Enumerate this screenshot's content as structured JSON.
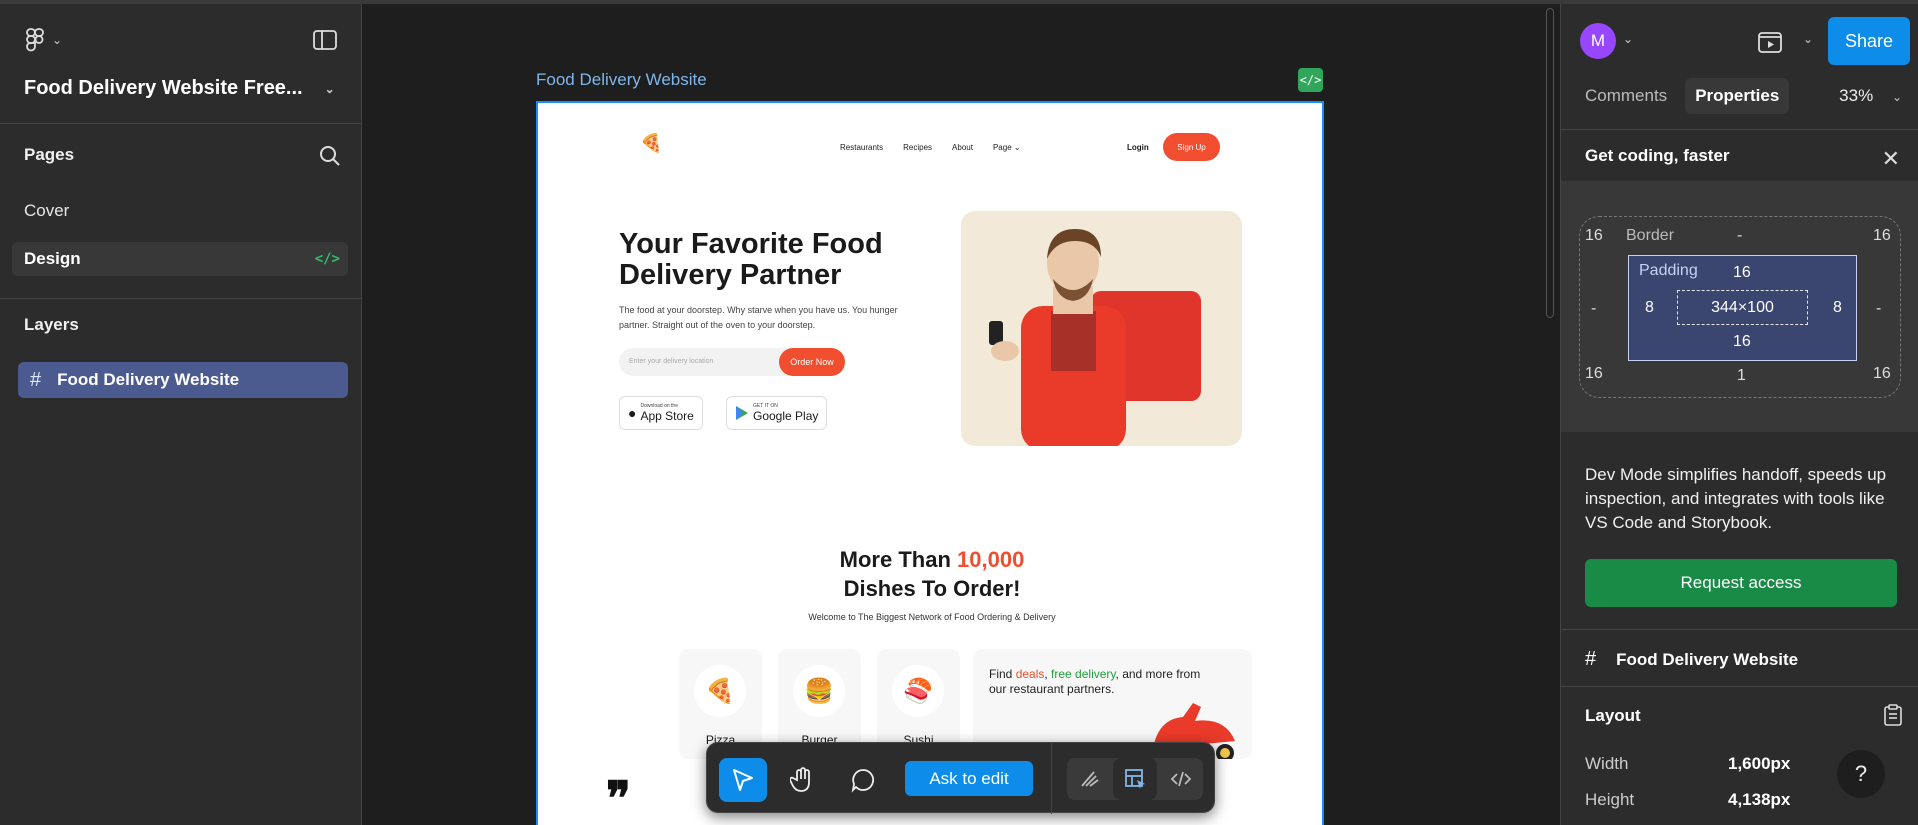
{
  "file": {
    "title": "Food Delivery Website Free..."
  },
  "pages": {
    "title": "Pages",
    "items": [
      {
        "label": "Cover"
      },
      {
        "label": "Design"
      }
    ],
    "code_glyph": "</>"
  },
  "layers": {
    "title": "Layers",
    "items": [
      {
        "label": "Food Delivery Website"
      }
    ],
    "hash_glyph": "#"
  },
  "canvas": {
    "frame_label": "Food Delivery Website",
    "code_glyph": "</>"
  },
  "site": {
    "nav": [
      "Restaurants",
      "Recipes",
      "About",
      "Page ⌄"
    ],
    "login": "Login",
    "signup": "Sign Up",
    "hero_title": "Your Favorite Food Delivery Partner",
    "hero_desc": "The food at your doorstep. Why starve when you have us. You hunger partner. Straight out of the oven to your doorstep.",
    "input_placeholder": "Enter your delivery location",
    "order_button": "Order Now",
    "app_store_small": "Download on the",
    "app_store": "App Store",
    "google_play_small": "GET IT ON",
    "google_play": "Google Play",
    "mid_title_pre": "More Than ",
    "mid_title_hl": "10,000",
    "mid_title_post": " Dishes To Order!",
    "mid_sub": "Welcome to The Biggest Network of Food Ordering & Delivery",
    "dishes": [
      {
        "name": "Pizza",
        "emoji": "🍕"
      },
      {
        "name": "Burger",
        "emoji": "🍔"
      },
      {
        "name": "Sushi",
        "emoji": "🍣"
      }
    ],
    "deal_pre": "Find ",
    "deal_r": "deals",
    "deal_mid": ", ",
    "deal_g": "free delivery",
    "deal_post": ", and more from our restaurant partners.",
    "quote": "❞",
    "logo": "🍕"
  },
  "toolbar": {
    "ask_label": "Ask to edit"
  },
  "right": {
    "avatar": "M",
    "share": "Share",
    "tabs": [
      "Comments",
      "Properties"
    ],
    "zoom": "33%",
    "panel_title": "Get coding, faster",
    "close": "✕",
    "box": {
      "border_label": "Border",
      "border_top": "-",
      "padding_label": "Padding",
      "outer": [
        "16",
        "16",
        "16",
        "16"
      ],
      "side_left": "-",
      "side_right": "-",
      "bottom_mid": "1",
      "pad_top": "16",
      "pad_left": "8",
      "pad_right": "8",
      "pad_bottom": "16",
      "size": "344×100"
    },
    "dev_text": "Dev Mode simplifies handoff, speeds up inspection, and integrates with tools like VS Code and Storybook.",
    "request_label": "Request access",
    "frame_name": "Food Delivery Website",
    "layout_title": "Layout",
    "width_label": "Width",
    "width_value": "1,600px",
    "height_label": "Height",
    "height_value": "4,138px",
    "help": "?"
  },
  "colors": {
    "accent": "#0d8ce9",
    "brand_red": "#f04e2f",
    "request_green": "#1a8a47",
    "layer_selected": "#4b5b8f"
  }
}
